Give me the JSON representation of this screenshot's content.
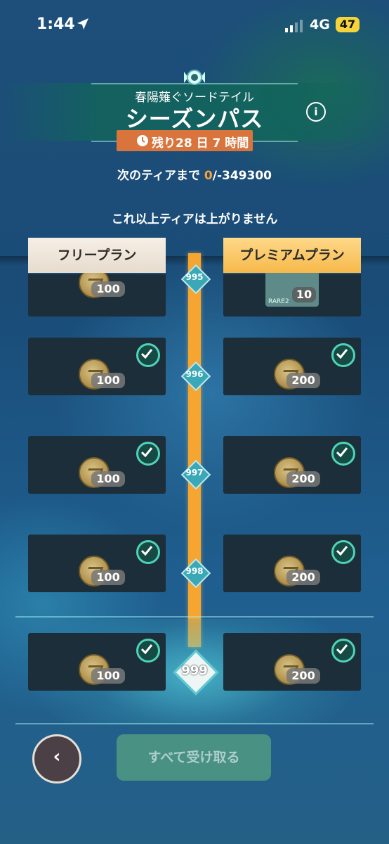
{
  "status_bar": {
    "time": "1:44",
    "network": "4G",
    "battery": "47"
  },
  "header": {
    "subtitle": "春陽薙ぐソードテイル",
    "title": "シーズンパス",
    "info_icon": "i",
    "timer_label": "残り28 日 7 時間"
  },
  "progress": {
    "prefix": "次のティアまで ",
    "current": "0",
    "suffix": "/-349300"
  },
  "notice": "これ以上ティアは上がりません",
  "tabs": {
    "free": "フリープラン",
    "premium": "プレミアムプラン"
  },
  "rows": [
    {
      "tier": "995",
      "free_amount": "100",
      "premium_amount": "10",
      "premium_item_label": "RARE2",
      "claimed": false
    },
    {
      "tier": "996",
      "free_amount": "100",
      "premium_amount": "200",
      "claimed": true
    },
    {
      "tier": "997",
      "free_amount": "100",
      "premium_amount": "200",
      "claimed": true
    },
    {
      "tier": "998",
      "free_amount": "100",
      "premium_amount": "200",
      "claimed": true
    },
    {
      "tier": "999",
      "free_amount": "100",
      "premium_amount": "200",
      "claimed": true
    }
  ],
  "buttons": {
    "back_icon": "‹",
    "claim_all": "すべて受け取る"
  },
  "colors": {
    "accent_orange": "#f6a531",
    "timer_bg": "#d9753c",
    "claim_green": "#4f9a82",
    "check_teal": "#4fd3b6"
  }
}
